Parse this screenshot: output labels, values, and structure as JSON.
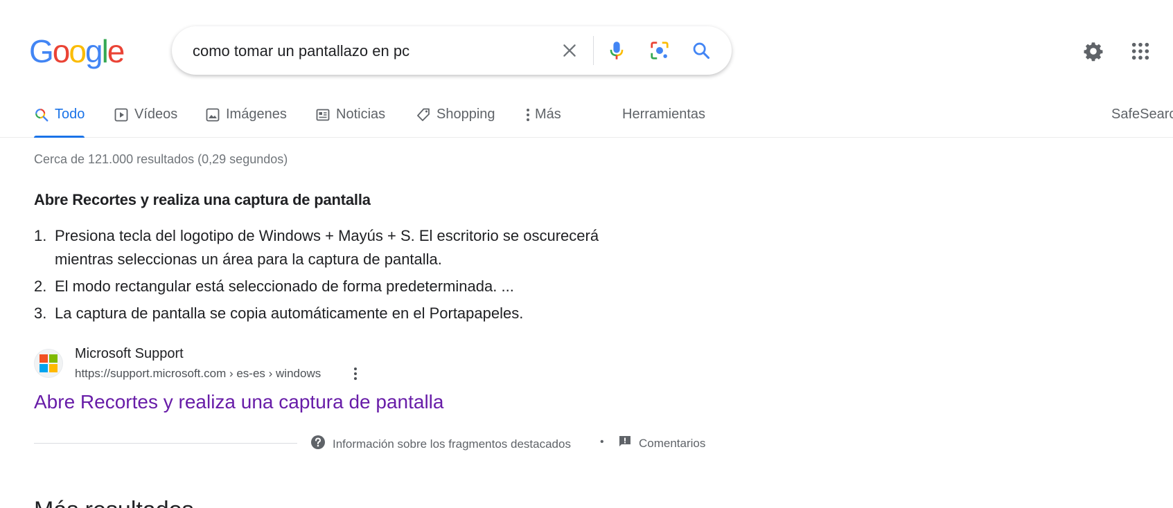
{
  "logo": {
    "letters": [
      "G",
      "o",
      "o",
      "g",
      "l",
      "e"
    ],
    "colors": [
      "#4285F4",
      "#EA4335",
      "#FBBC05",
      "#4285F4",
      "#34A853",
      "#EA4335"
    ]
  },
  "search": {
    "query": "como tomar un pantallazo en pc",
    "icons": [
      "close-icon",
      "microphone-icon",
      "camera-lens-icon",
      "search-icon"
    ]
  },
  "header_icons": [
    "gear-icon",
    "apps-grid-icon"
  ],
  "tabs": [
    {
      "label": "Todo",
      "icon": "search-icon",
      "active": true
    },
    {
      "label": "Vídeos",
      "icon": "play-icon"
    },
    {
      "label": "Imágenes",
      "icon": "image-icon"
    },
    {
      "label": "Noticias",
      "icon": "news-icon"
    },
    {
      "label": "Shopping",
      "icon": "tag-icon"
    },
    {
      "label": "Más",
      "icon": "more-vert-icon"
    },
    {
      "label": "Herramientas"
    },
    {
      "label": "SafeSearc"
    }
  ],
  "stats": "Cerca de 121.000 resultados (0,29 segundos)",
  "snippet": {
    "heading": "Abre Recortes y realiza una captura de pantalla",
    "steps": [
      {
        "num": "1.",
        "text": "Presiona tecla del logotipo de Windows + Mayús + S. El escritorio se oscurecerá mientras seleccionas un área para la captura de pantalla."
      },
      {
        "num": "2.",
        "text": "El modo rectangular está seleccionado de forma predeterminada. ..."
      },
      {
        "num": "3.",
        "text": "La captura de pantalla se copia automáticamente en el Portapapeles."
      }
    ]
  },
  "source": {
    "site_name": "Microsoft Support",
    "url": "https://support.microsoft.com › es-es › windows",
    "favicon_colors": [
      "#F25022",
      "#7FBA00",
      "#00A4EF",
      "#FFB900"
    ]
  },
  "result_title": "Abre Recortes y realiza una captura de pantalla",
  "footer": {
    "info_label": "Información sobre los fragmentos destacados",
    "bullet": "•",
    "feedback_label": "Comentarios"
  },
  "next_heading": "Más resultados"
}
